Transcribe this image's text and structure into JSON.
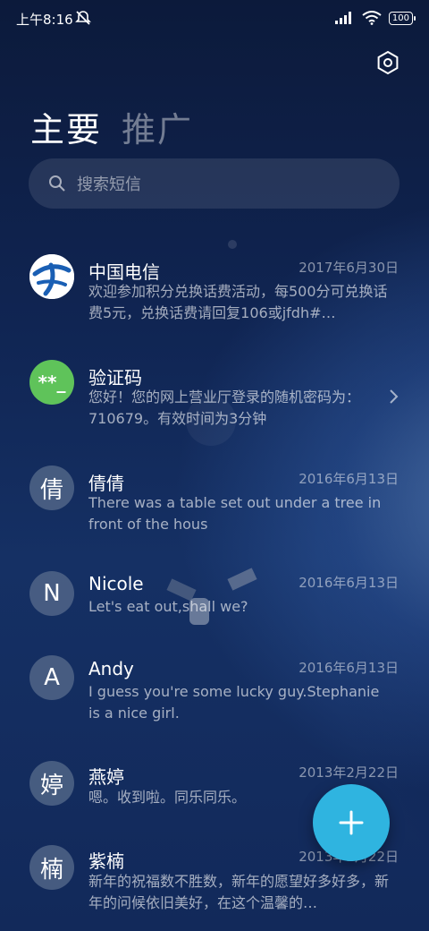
{
  "status_bar": {
    "time": "上午8:16",
    "battery": "100"
  },
  "tabs": [
    {
      "label": "主要",
      "active": true
    },
    {
      "label": "推广",
      "active": false
    }
  ],
  "search": {
    "placeholder": "搜索短信"
  },
  "conversations": [
    {
      "name": "中国电信",
      "date": "2017年6月30日",
      "preview": "欢迎参加积分兑换话费活动，每500分可兑换话费5元，兑换话费请回复106或jfdh#…",
      "avatar": "china-telecom-logo"
    },
    {
      "name": "验证码",
      "date": "",
      "preview": "您好！您的网上营业厅登录的随机密码为：710679。有效时间为3分钟",
      "avatar_text": "**_",
      "avatar_color": "#5fc35a"
    },
    {
      "name": "倩倩",
      "date": "2016年6月13日",
      "preview": "There was a table set out under a tree in front of the hous",
      "avatar_text": "倩"
    },
    {
      "name": "Nicole",
      "date": "2016年6月13日",
      "preview": "Let's eat out,shall we?",
      "avatar_text": "N"
    },
    {
      "name": "Andy",
      "date": "2016年6月13日",
      "preview": "I guess you're some lucky guy.Stephanie is a nice girl.",
      "avatar_text": "A"
    },
    {
      "name": "燕婷",
      "date": "2013年2月22日",
      "preview": "嗯。收到啦。同乐同乐。",
      "avatar_text": "婷"
    },
    {
      "name": "紫楠",
      "date": "2013年2月22日",
      "preview": "新年的祝福数不胜数，新年的愿望好多好多，新年的问候依旧美好，在这个温馨的…",
      "avatar_text": "楠"
    }
  ],
  "colors": {
    "accent": "#2fb4e0",
    "captcha_green": "#5fc35a",
    "telecom_blue": "#1a5fb4"
  }
}
